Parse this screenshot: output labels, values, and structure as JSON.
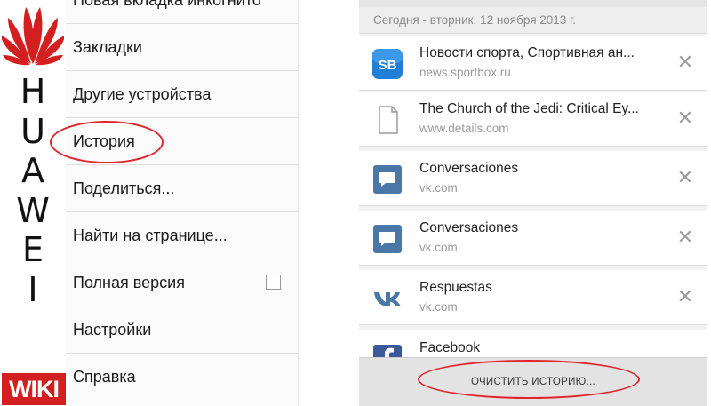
{
  "brand": {
    "letters": [
      "H",
      "U",
      "A",
      "W",
      "E",
      "I"
    ],
    "badge": "WIKI",
    "color": "#d21f1f"
  },
  "menu": {
    "items": [
      {
        "label": "Новая вкладка инкогнито"
      },
      {
        "label": "Закладки"
      },
      {
        "label": "Другие устройства"
      },
      {
        "label": "История"
      },
      {
        "label": "Поделиться..."
      },
      {
        "label": "Найти на странице..."
      },
      {
        "label": "Полная версия",
        "checkbox": true
      },
      {
        "label": "Настройки"
      },
      {
        "label": "Справка"
      }
    ]
  },
  "history": {
    "date_header": "Сегодня - вторник, 12 ноября 2013 г.",
    "items": [
      {
        "title": "Новости спорта, Спортивная ан...",
        "url": "news.sportbox.ru",
        "icon": "sportbox-icon"
      },
      {
        "title": "The Church of the Jedi: Critical Ey...",
        "url": "www.details.com",
        "icon": "page-icon"
      },
      {
        "title": "Conversaciones",
        "url": "vk.com",
        "icon": "chat-icon"
      },
      {
        "title": "Conversaciones",
        "url": "vk.com",
        "icon": "chat-icon"
      },
      {
        "title": "Respuestas",
        "url": "vk.com",
        "icon": "vk-icon"
      },
      {
        "title": "Facebook",
        "url": "",
        "icon": "facebook-icon"
      }
    ],
    "close_glyph": "✕",
    "clear_button": "ОЧИСТИТЬ ИСТОРИЮ..."
  },
  "colors": {
    "annotation": "#e0242c",
    "vk_blue": "#4a76a8",
    "sportbox_blue": "#1f7fd8"
  }
}
